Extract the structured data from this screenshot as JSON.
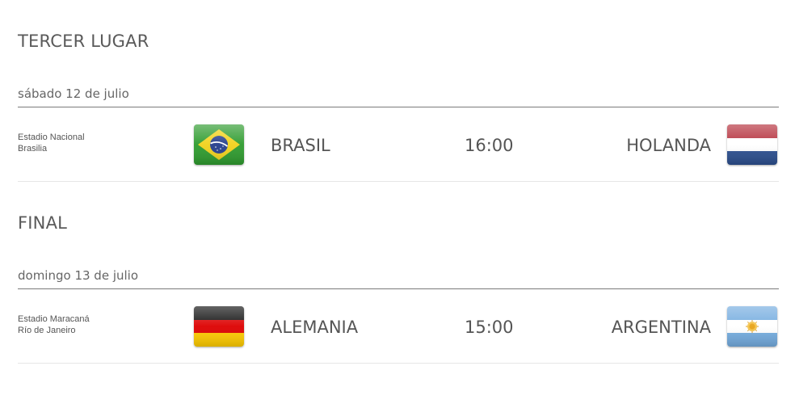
{
  "stages": [
    {
      "title": "TERCER LUGAR",
      "date": "sábado 12 de julio",
      "venue": {
        "stadium": "Estadio Nacional",
        "city": "Brasilia"
      },
      "home": {
        "name": "BRASIL",
        "flag": "brazil-flag"
      },
      "time": "16:00",
      "away": {
        "name": "HOLANDA",
        "flag": "netherlands-flag"
      }
    },
    {
      "title": "FINAL",
      "date": "domingo 13 de julio",
      "venue": {
        "stadium": "Estadio Maracaná",
        "city": "Río de Janeiro"
      },
      "home": {
        "name": "ALEMANIA",
        "flag": "germany-flag"
      },
      "time": "15:00",
      "away": {
        "name": "ARGENTINA",
        "flag": "argentina-flag"
      }
    }
  ],
  "colors": {
    "divider": "#7a7a7a",
    "row_border": "#e6e6e6",
    "text": "#555555",
    "brazil_green": "#2e9b2e",
    "brazil_yellow": "#f2d21b",
    "brazil_blue": "#253e8c",
    "netherlands_red": "#b5303c",
    "netherlands_blue": "#2c4f8f",
    "germany_red": "#dd0000",
    "germany_gold": "#ffcc00",
    "argentina_blue": "#74acdf",
    "argentina_sun": "#e8a317"
  }
}
